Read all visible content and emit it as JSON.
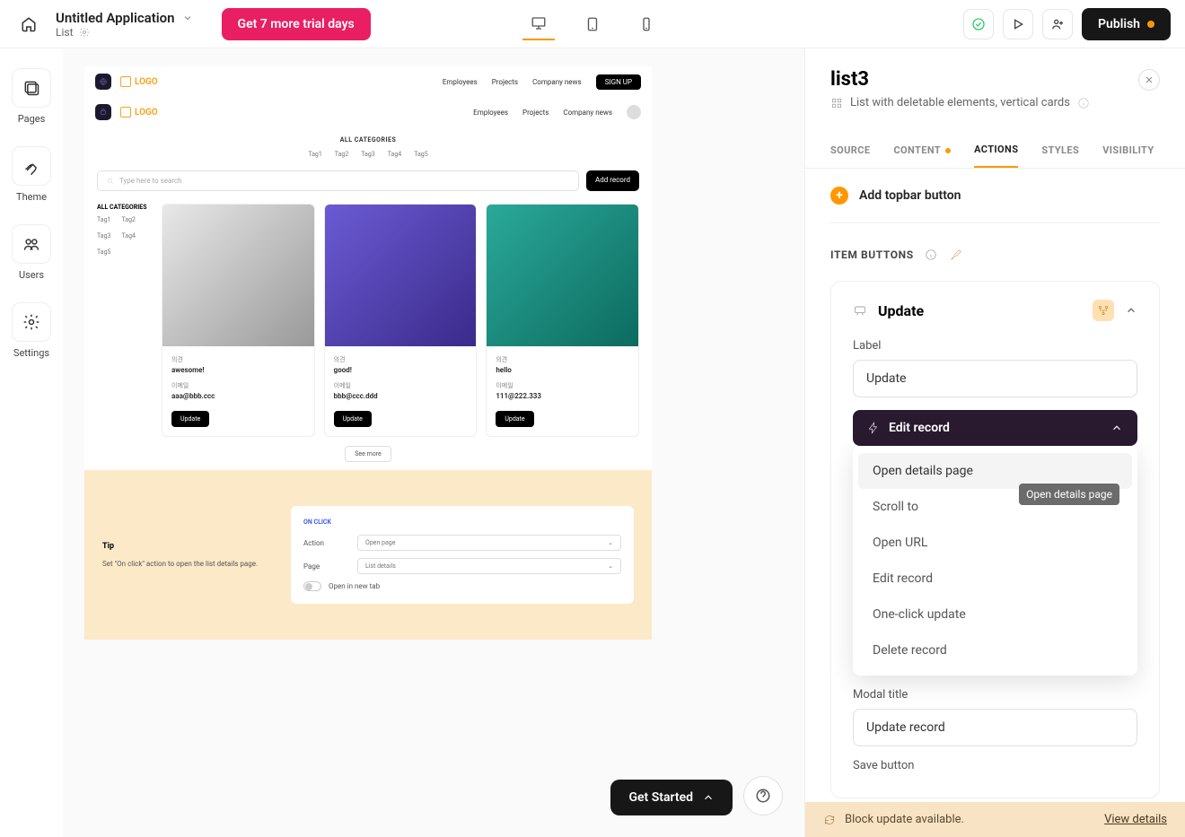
{
  "header": {
    "app_title": "Untitled Application",
    "breadcrumb": "List",
    "trial_cta": "Get 7 more trial days",
    "publish": "Publish"
  },
  "leftnav": {
    "pages": "Pages",
    "theme": "Theme",
    "users": "Users",
    "settings": "Settings"
  },
  "canvas": {
    "logo_text": "LOGO",
    "nav": {
      "employees": "Employees",
      "projects": "Projects",
      "company_news": "Company news",
      "signup": "SIGN UP"
    },
    "all_categories": "ALL CATEGORIES",
    "tags": [
      "Tag1",
      "Tag2",
      "Tag3",
      "Tag4",
      "Tag5"
    ],
    "search_placeholder": "Type here to search",
    "add_record": "Add record",
    "sidebar_title": "ALL CATEGORIES",
    "cards": [
      {
        "opinion_label": "의견",
        "opinion": "awesome!",
        "email_label": "이메일",
        "email": "aaa@bbb.ccc",
        "button": "Update"
      },
      {
        "opinion_label": "의견",
        "opinion": "good!",
        "email_label": "이메일",
        "email": "bbb@ccc.ddd",
        "button": "Update"
      },
      {
        "opinion_label": "의견",
        "opinion": "hello",
        "email_label": "이메일",
        "email": "111@222.333",
        "button": "Update"
      }
    ],
    "see_more": "See more",
    "tip": {
      "title": "Tip",
      "body": "Set \"On click\" action to open the list details page.",
      "on_click": "ON CLICK",
      "action_label": "Action",
      "action_value": "Open page",
      "page_label": "Page",
      "page_value": "List details",
      "newtab": "Open in new tab"
    }
  },
  "footer": {
    "get_started": "Get Started"
  },
  "panel": {
    "title": "list3",
    "subtitle": "List with deletable elements, vertical cards",
    "tabs": {
      "source": "SOURCE",
      "content": "CONTENT",
      "actions": "ACTIONS",
      "styles": "STYLES",
      "visibility": "VISIBILITY"
    },
    "add_topbar": "Add topbar button",
    "item_buttons": "ITEM BUTTONS",
    "update_card": {
      "title": "Update",
      "label_field": "Label",
      "label_value": "Update",
      "edit_record": "Edit record",
      "modal_title_label": "Modal title",
      "modal_title_value": "Update record",
      "save_button_label": "Save button"
    },
    "dropdown": {
      "open_details": "Open details page",
      "scroll_to": "Scroll to",
      "open_url": "Open URL",
      "edit_record": "Edit record",
      "one_click": "One-click update",
      "delete_record": "Delete record",
      "tooltip": "Open details page"
    },
    "snackbar": {
      "msg": "Block update available.",
      "link": "View details"
    }
  }
}
